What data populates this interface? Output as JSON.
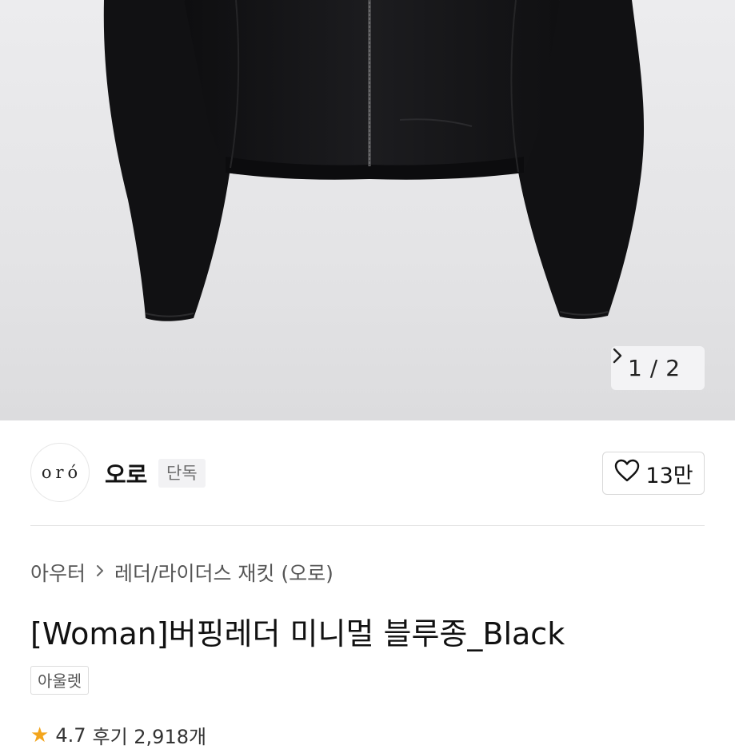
{
  "gallery": {
    "current": "1",
    "separator": "/",
    "total": "2",
    "next_icon": "chevron-right-icon"
  },
  "brand": {
    "logo_text": "oró",
    "name": "오로",
    "badge": "단독",
    "like_icon": "heart-outline-icon",
    "like_count": "13만"
  },
  "breadcrumb": {
    "category": "아우터",
    "separator_icon": "chevron-right-icon",
    "subcategory": "레더/라이더스 재킷 (오로)"
  },
  "product": {
    "title": "[Woman]버핑레더 미니멀 블루종_Black",
    "tag": "아울렛"
  },
  "rating": {
    "star_icon": "star-icon",
    "score": "4.7",
    "reviews": "후기 2,918개"
  },
  "colors": {
    "background": "#ffffff",
    "hero_bg": "#e6e6e8",
    "jacket": "#151517",
    "star": "#f3a51c"
  }
}
